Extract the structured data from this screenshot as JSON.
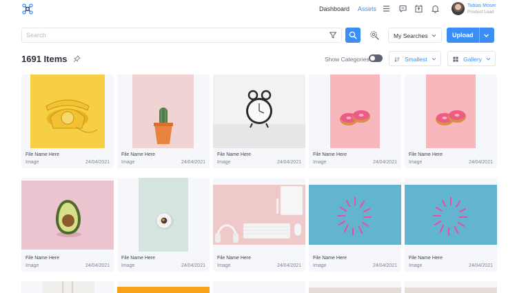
{
  "header": {
    "nav": [
      {
        "label": "Dashboard"
      },
      {
        "label": "Assets"
      }
    ],
    "user": {
      "name": "Tobias Moser",
      "role": "Product Lead"
    }
  },
  "toolbar": {
    "search_placeholder": "Search",
    "saved_searches": "My Searches",
    "upload": "Upload"
  },
  "listing": {
    "count_label": "1691 Items",
    "show_categories": "Show Categories",
    "show_categories_on": false,
    "sort": "Smallest",
    "view": "Gallery"
  },
  "colors": {
    "accent": "#3a8ef6"
  },
  "assets": [
    {
      "name": "File Name Here",
      "type": "Image",
      "date": "24/04/2021",
      "thumb": "yellow-telephone"
    },
    {
      "name": "File Name Here",
      "type": "Image",
      "date": "24/04/2021",
      "thumb": "cactus-pot"
    },
    {
      "name": "File Name Here",
      "type": "Image",
      "date": "24/04/2021",
      "thumb": "alarm-clock"
    },
    {
      "name": "File Name Here",
      "type": "Image",
      "date": "24/04/2021",
      "thumb": "donuts"
    },
    {
      "name": "File Name Here",
      "type": "Image",
      "date": "24/04/2021",
      "thumb": "donuts"
    },
    {
      "name": "File Name Here",
      "type": "Image",
      "date": "24/04/2021",
      "thumb": "avocado"
    },
    {
      "name": "File Name Here",
      "type": "Image",
      "date": "24/04/2021",
      "thumb": "coffee-cup"
    },
    {
      "name": "File Name Here",
      "type": "Image",
      "date": "24/04/2021",
      "thumb": "desk-setup"
    },
    {
      "name": "File Name Here",
      "type": "Image",
      "date": "24/04/2021",
      "thumb": "paperclips"
    },
    {
      "name": "File Name Here",
      "type": "Image",
      "date": "24/04/2021",
      "thumb": "paperclips"
    }
  ]
}
